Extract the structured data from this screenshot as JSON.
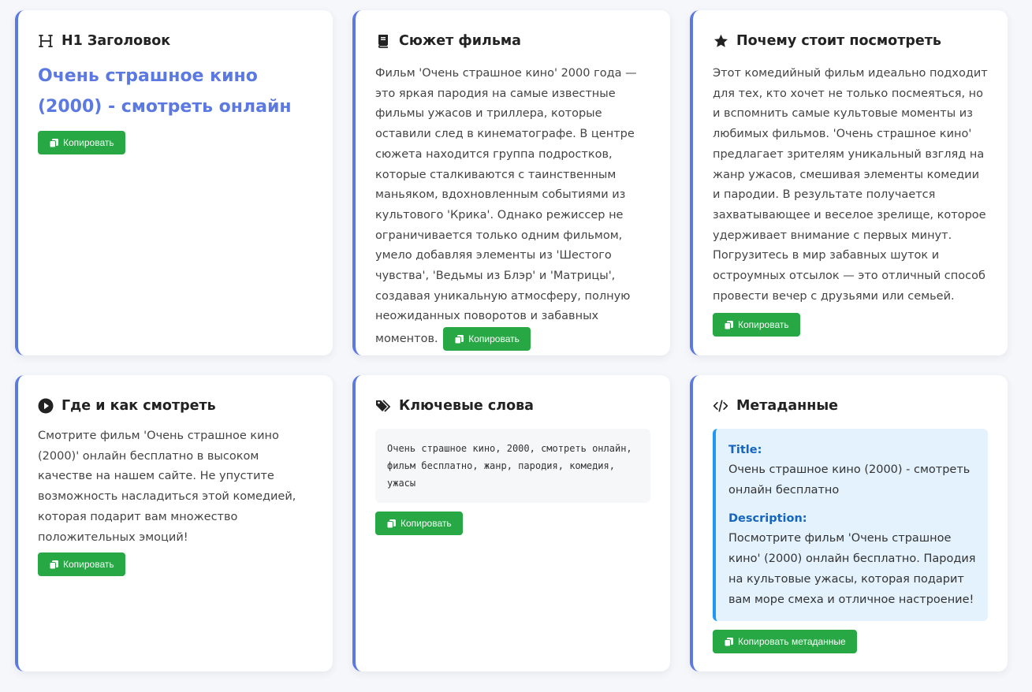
{
  "colors": {
    "accent": "#5b79e0",
    "button": "#28a745",
    "meta_background": "#e3f2fd",
    "meta_border": "#2196f3",
    "meta_label": "#1565c0"
  },
  "cards": {
    "h1": {
      "icon": "heading-icon",
      "title": "H1 Заголовок",
      "heading_text": "Очень страшное кино (2000) - смотреть онлайн",
      "button": "Копировать"
    },
    "plot": {
      "icon": "book-icon",
      "title": "Сюжет фильма",
      "text": "Фильм 'Очень страшное кино' 2000 года — это яркая пародия на самые известные фильмы ужасов и триллера, которые оставили след в кинематографе. В центре сюжета находится группа подростков, которые сталкиваются с таинственным маньяком, вдохновленным событиями из культового 'Крика'. Однако режиссер не ограничивается только одним фильмом, умело добавляя элементы из 'Шестого чувства', 'Ведьмы из Блэр' и 'Матрицы', создавая уникальную атмосферу, полную неожиданных поворотов и забавных моментов.",
      "button": "Копировать"
    },
    "why": {
      "icon": "star-icon",
      "title": "Почему стоит посмотреть",
      "text": "Этот комедийный фильм идеально подходит для тех, кто хочет не только посмеяться, но и вспомнить самые культовые моменты из любимых фильмов. 'Очень страшное кино' предлагает зрителям уникальный взгляд на жанр ужасов, смешивая элементы комедии и пародии. В результате получается захватывающее и веселое зрелище, которое удерживает внимание с первых минут. Погрузитесь в мир забавных шуток и остроумных отсылок — это отличный способ провести вечер с друзьями или семьей.",
      "button": "Копировать"
    },
    "where": {
      "icon": "play-circle-icon",
      "title": "Где и как смотреть",
      "text": "Смотрите фильм 'Очень страшное кино (2000)' онлайн бесплатно в высоком качестве на нашем сайте. Не упустите возможность насладиться этой комедией, которая подарит вам множество положительных эмоций!",
      "button": "Копировать"
    },
    "keywords": {
      "icon": "tags-icon",
      "title": "Ключевые слова",
      "text": "Очень страшное кино, 2000, смотреть онлайн, фильм бесплатно, жанр, пародия, комедия, ужасы",
      "button": "Копировать"
    },
    "metadata": {
      "icon": "code-icon",
      "title": "Метаданные",
      "title_label": "Title:",
      "title_value": "Очень страшное кино (2000) - смотреть онлайн бесплатно",
      "description_label": "Description:",
      "description_value": "Посмотрите фильм 'Очень страшное кино' (2000) онлайн бесплатно. Пародия на культовые ужасы, которая подарит вам море смеха и отличное настроение!",
      "button": "Копировать метаданные"
    }
  }
}
